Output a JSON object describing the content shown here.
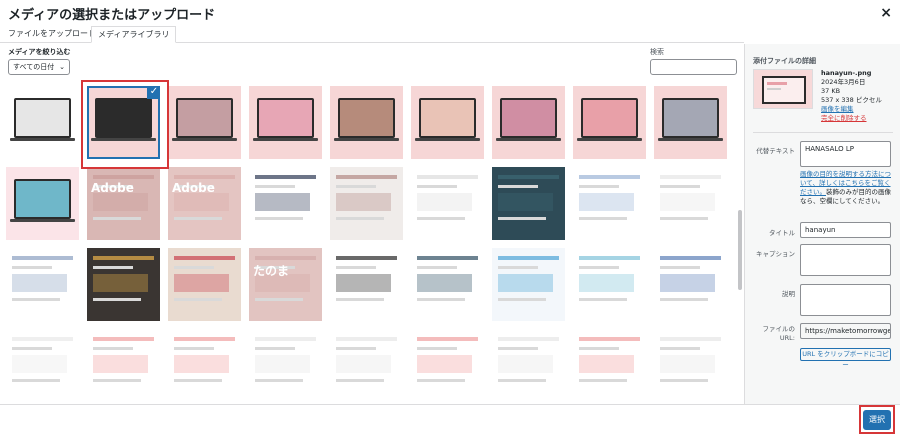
{
  "modal": {
    "title": "メディアの選択またはアップロード",
    "close_label": "×"
  },
  "tabs": [
    {
      "label": "ファイルをアップロード",
      "active": false
    },
    {
      "label": "メディアライブラリ",
      "active": true
    }
  ],
  "toolbar": {
    "filter_label": "メディアを絞り込む",
    "filter_value": "すべての日付",
    "search_label": "検索"
  },
  "grid": {
    "thumbnails": [
      {
        "text": "",
        "bg": "#ffffff",
        "accent": "#e6e6e6",
        "selected": false
      },
      {
        "text": "",
        "bg": "#f6d6d6",
        "accent": "#2b2b2b",
        "selected": true
      },
      {
        "text": "",
        "bg": "#f6d6d6",
        "accent": "#c49ea2",
        "selected": false
      },
      {
        "text": "",
        "bg": "#f6d6d6",
        "accent": "#e7a6b5",
        "selected": false
      },
      {
        "text": "",
        "bg": "#f6d6d6",
        "accent": "#b68b7b",
        "selected": false
      },
      {
        "text": "",
        "bg": "#f6d6d6",
        "accent": "#e9c3b6",
        "selected": false
      },
      {
        "text": "",
        "bg": "#f6d6d6",
        "accent": "#d08ea3",
        "selected": false
      },
      {
        "text": "",
        "bg": "#f6d6d6",
        "accent": "#e8a0a8",
        "selected": false
      },
      {
        "text": "",
        "bg": "#f6d6d6",
        "accent": "#a4a7b4",
        "selected": false
      },
      {
        "text": "",
        "bg": "#fbe4e8",
        "accent": "#6fb7c9",
        "selected": false
      },
      {
        "text": "Adobe",
        "bg": "#d9b7b4",
        "accent": "#c99a97",
        "selected": false
      },
      {
        "text": "Adobe",
        "bg": "#e4c5c2",
        "accent": "#d9aaa7",
        "selected": false
      },
      {
        "text": "",
        "bg": "#ffffff",
        "accent": "#2f3a55",
        "selected": false
      },
      {
        "text": "",
        "bg": "#f0ecea",
        "accent": "#b28a84",
        "selected": false
      },
      {
        "text": "",
        "bg": "#ffffff",
        "accent": "#dcdcdc",
        "selected": false
      },
      {
        "text": "",
        "bg": "#2e4b57",
        "accent": "#3d6a75",
        "selected": false
      },
      {
        "text": "",
        "bg": "#ffffff",
        "accent": "#9bb4d6",
        "selected": false
      },
      {
        "text": "",
        "bg": "#ffffff",
        "accent": "#e6e6e6",
        "selected": false
      },
      {
        "text": "",
        "bg": "#ffffff",
        "accent": "#8aa0c0",
        "selected": false
      },
      {
        "text": "",
        "bg": "#3a3532",
        "accent": "#e9b24a",
        "selected": false
      },
      {
        "text": "",
        "bg": "#e9dbd0",
        "accent": "#c8434f",
        "selected": false
      },
      {
        "text": "たのま",
        "bg": "#e2c4c1",
        "accent": "#d3a9a6",
        "selected": false
      },
      {
        "text": "",
        "bg": "#ffffff",
        "accent": "#2a2a2a",
        "selected": false
      },
      {
        "text": "",
        "bg": "#ffffff",
        "accent": "#2f4f63",
        "selected": false
      },
      {
        "text": "",
        "bg": "#f3f7fb",
        "accent": "#4aa3d5",
        "selected": false
      },
      {
        "text": "",
        "bg": "#ffffff",
        "accent": "#7fc2d8",
        "selected": false
      },
      {
        "text": "",
        "bg": "#ffffff",
        "accent": "#5b7fb7",
        "selected": false
      },
      {
        "text": "",
        "bg": "#ffffff",
        "accent": "#e8e8e8",
        "selected": false
      },
      {
        "text": "",
        "bg": "#ffffff",
        "accent": "#f0a0a0",
        "selected": false
      },
      {
        "text": "",
        "bg": "#ffffff",
        "accent": "#f0a0a0",
        "selected": false
      },
      {
        "text": "",
        "bg": "#ffffff",
        "accent": "#e6e6e6",
        "selected": false
      },
      {
        "text": "",
        "bg": "#ffffff",
        "accent": "#e6e6e6",
        "selected": false
      },
      {
        "text": "",
        "bg": "#ffffff",
        "accent": "#f0a0a0",
        "selected": false
      },
      {
        "text": "",
        "bg": "#ffffff",
        "accent": "#e6e6e6",
        "selected": false
      },
      {
        "text": "",
        "bg": "#ffffff",
        "accent": "#f0a0a0",
        "selected": false
      },
      {
        "text": "",
        "bg": "#ffffff",
        "accent": "#e6e6e6",
        "selected": false
      }
    ]
  },
  "details": {
    "title": "添付ファイルの詳細",
    "file_name": "hanayun-.png",
    "date": "2024年3月6日",
    "size": "37 KB",
    "dimensions": "537 x 338 ピクセル",
    "edit_link": "画像を編集",
    "delete_link": "完全に削除する",
    "alt_label": "代替テキスト",
    "alt_value": "HANASALO LP",
    "alt_help_link": "画像の目的を説明する方法について、詳しくはこちらをご覧ください。",
    "alt_help_text": "装飾のみが目的の画像なら、空欄にしてください。",
    "title_label": "タイトル",
    "title_value": "hanayun",
    "caption_label": "キャプション",
    "caption_value": "",
    "description_label": "説明",
    "description_value": "",
    "url_label": "ファイルの URL:",
    "url_value": "https://maketomorrowgen",
    "copy_button": "URL をクリップボードにコピー"
  },
  "footer": {
    "select_button": "選択"
  },
  "colors": {
    "accent": "#2271b1",
    "highlight": "#d63638"
  }
}
